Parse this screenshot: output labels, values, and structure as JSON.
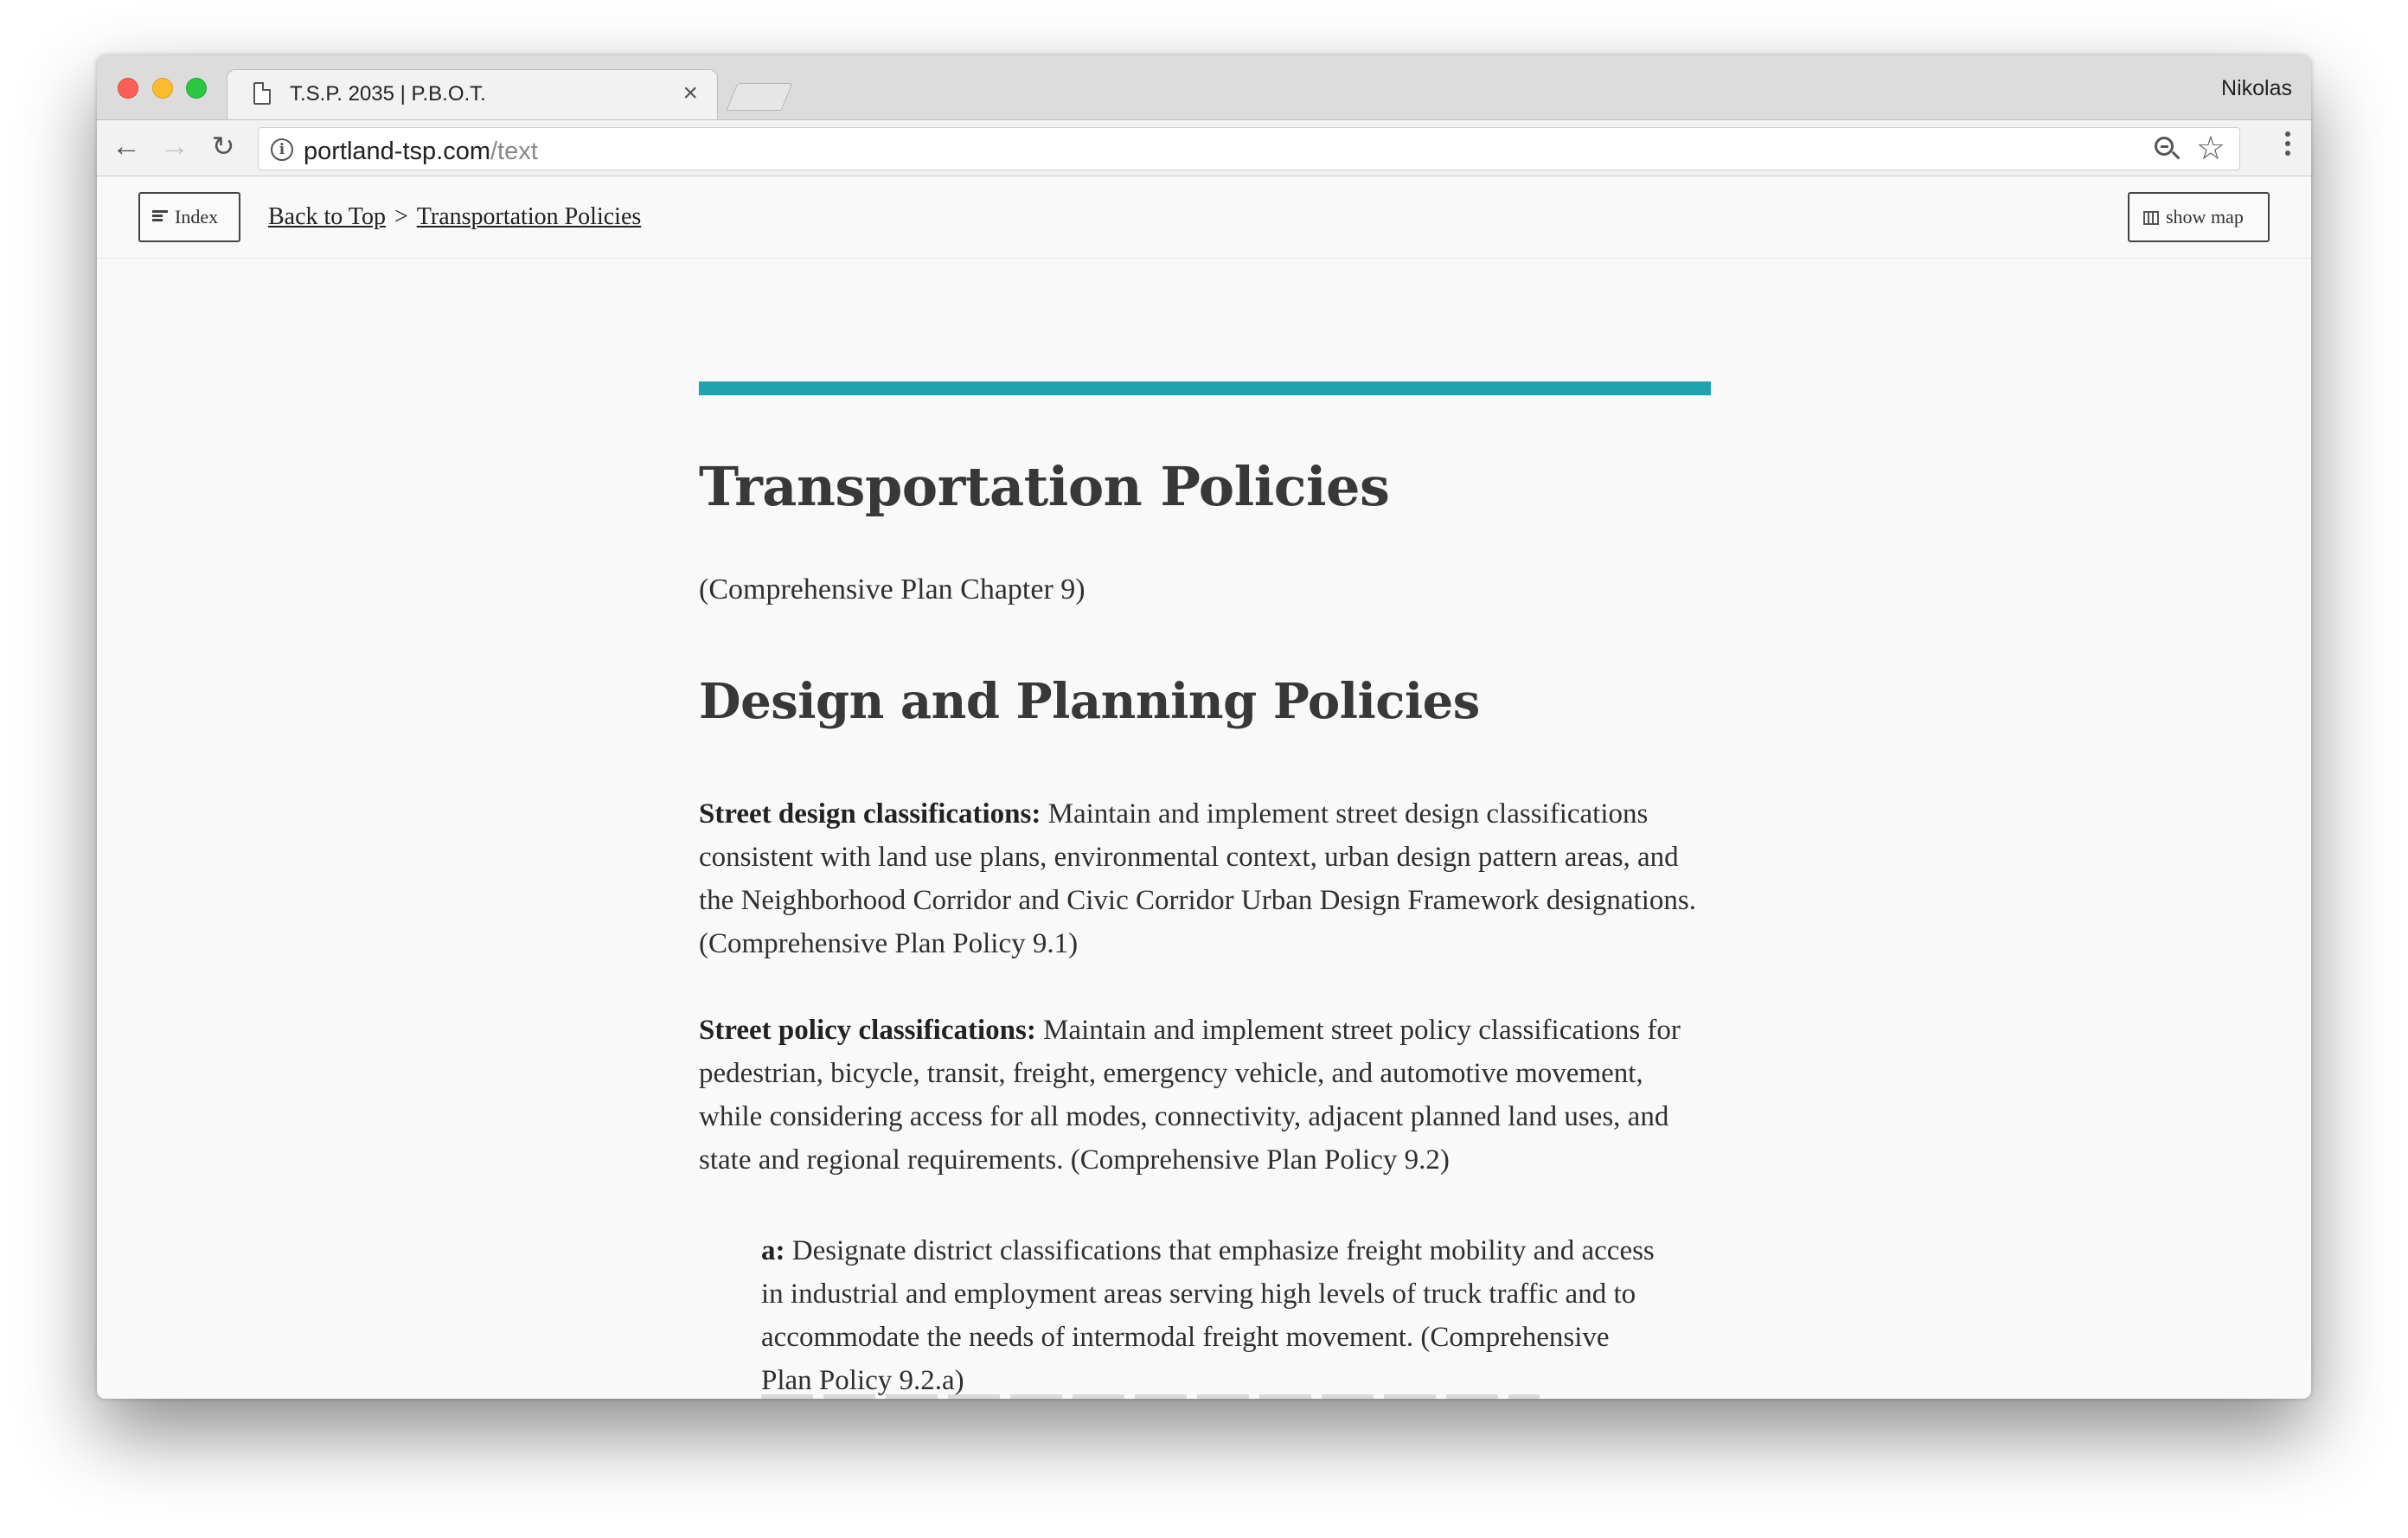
{
  "browser": {
    "tab_title": "T.S.P. 2035 | P.B.O.T.",
    "tab_close": "×",
    "profile_name": "Nikolas",
    "url_host": "portland-tsp.com",
    "url_path": "/text",
    "icons": {
      "back": "←",
      "forward": "→",
      "reload": "↻",
      "star": "☆",
      "info": "i"
    }
  },
  "page_header": {
    "index_label": "Index",
    "breadcrumb": {
      "back_to_top": "Back to Top",
      "separator": ">",
      "current": "Transportation Policies"
    },
    "show_map_label": "show map"
  },
  "article": {
    "accent_color": "#1ea4ae",
    "title": "Transportation Policies",
    "subtitle": "(Comprehensive Plan Chapter 9)",
    "section_title": "Design and Planning Policies",
    "policies": [
      {
        "heading": "Street design classifications:",
        "text": " Maintain and implement street design classifications consistent with land use plans, environmental context, urban design pattern areas, and the Neighborhood Corridor and Civic Corridor Urban Design Framework designations. (Comprehensive Plan Policy 9.1)"
      },
      {
        "heading": "Street policy classifications:",
        "text": " Maintain and implement street policy classifications for pedestrian, bicycle, transit, freight, emergency vehicle, and automotive movement, while considering access for all modes, connectivity, adjacent planned land uses, and state and regional requirements. (Comprehensive Plan Policy 9.2)"
      }
    ],
    "sub_policy": {
      "label": "a:",
      "text": " Designate district classifications that emphasize freight mobility and access in industrial and employment areas serving high levels of truck traffic and to accommodate the needs of intermodal freight movement. (Comprehensive Plan Policy 9.2.a)"
    }
  }
}
